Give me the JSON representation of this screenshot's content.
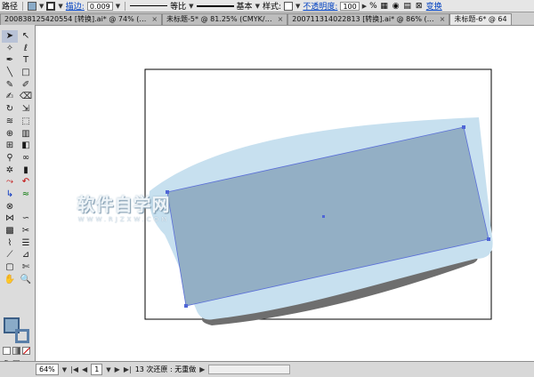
{
  "control_bar": {
    "tool_label": "路径",
    "fill_color": "#8aabc8",
    "stroke_link": "描边:",
    "stroke_value": "0.009",
    "profile_label": "等比",
    "brush_label": "基本",
    "style_label": "样式:",
    "opacity_link": "不透明度:",
    "opacity_value": "100",
    "opacity_unit": "%",
    "transform_link": "变换"
  },
  "tabs": [
    {
      "label": "20083812542055​4 [转换].ai* @ 74% (…"
    },
    {
      "label": "未标题-5* @ 81.25% (CMYK/…"
    },
    {
      "label": "200711314022813 [转换].ai* @ 86% (…"
    },
    {
      "label": "未标题-6* @ 64"
    }
  ],
  "status_bar": {
    "zoom": "64%",
    "page": "1",
    "undo_text": "13 次还原 : 无重做"
  },
  "watermark": {
    "title": "软件自学网",
    "url": "WWW.RJZXW.COM"
  },
  "colors": {
    "shape_fill": "#93afc5",
    "shape_stroke": "#5a6fd8",
    "glow": "#c7e0ef",
    "shadow": "#6e6e6e"
  }
}
